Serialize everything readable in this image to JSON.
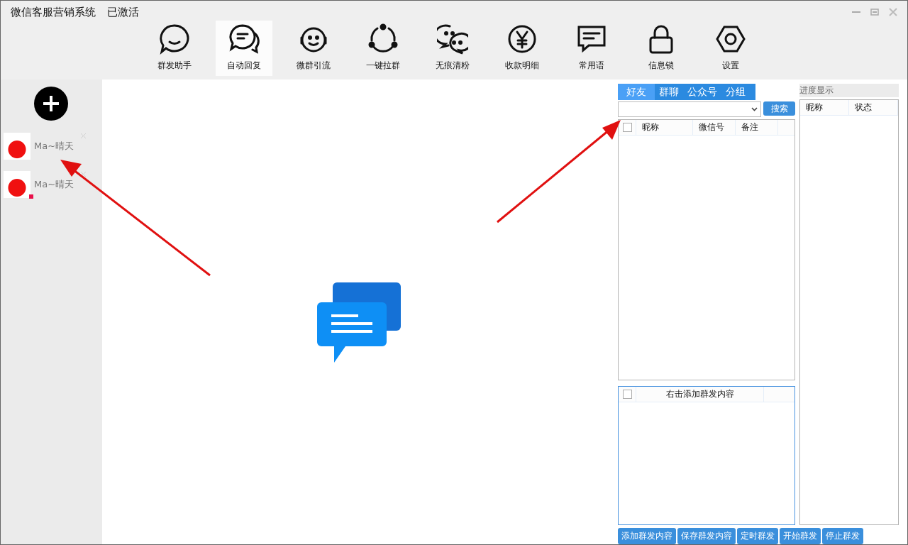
{
  "window": {
    "title": "微信客服营销系统",
    "status": "已激活"
  },
  "toolbar": [
    {
      "label": "群发助手",
      "selected": false
    },
    {
      "label": "自动回复",
      "selected": true
    },
    {
      "label": "微群引流",
      "selected": false
    },
    {
      "label": "一键拉群",
      "selected": false
    },
    {
      "label": "无痕清粉",
      "selected": false
    },
    {
      "label": "收款明细",
      "selected": false
    },
    {
      "label": "常用语",
      "selected": false
    },
    {
      "label": "信息锁",
      "selected": false
    },
    {
      "label": "设置",
      "selected": false
    }
  ],
  "accounts": [
    {
      "name": "Ma~晴天",
      "alert": false
    },
    {
      "name": "Ma~晴天",
      "alert": true
    }
  ],
  "contacts": {
    "tabs": [
      {
        "label": "好友",
        "selected": true
      },
      {
        "label": "群聊",
        "selected": false
      },
      {
        "label": "公众号",
        "selected": false
      },
      {
        "label": "分组",
        "selected": false
      }
    ],
    "search_button": "搜索",
    "columns": [
      "昵称",
      "微信号",
      "备注"
    ],
    "checked": false
  },
  "content_table": {
    "header": "右击添加群发内容",
    "checked": false
  },
  "progress": {
    "title": "进度显示",
    "columns": [
      "昵称",
      "状态"
    ]
  },
  "buttons": [
    "添加群发内容",
    "保存群发内容",
    "定时群发",
    "开始群发",
    "停止群发"
  ]
}
